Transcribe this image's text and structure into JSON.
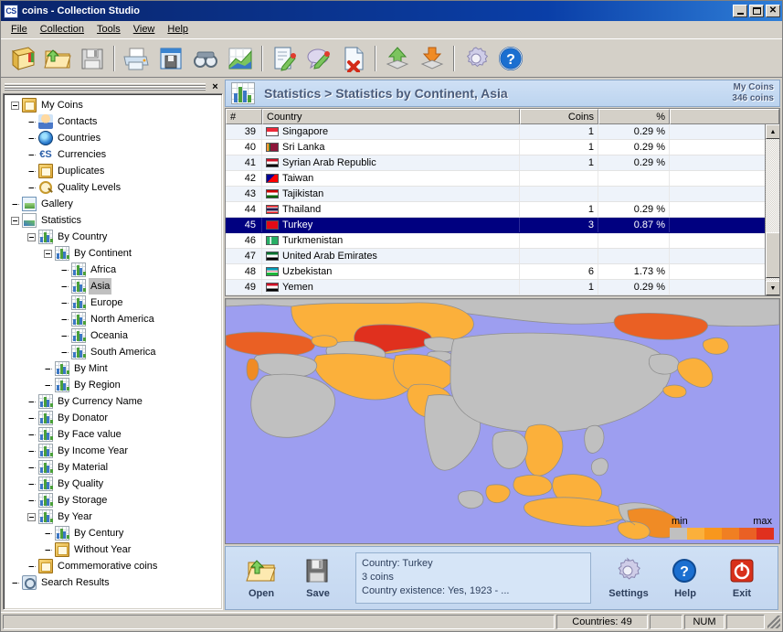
{
  "window": {
    "title": "coins - Collection Studio",
    "icon": "CS",
    "buttons": {
      "minimize": "minimize-button",
      "maximize": "maximize-button",
      "close": "close-button"
    }
  },
  "menu": [
    {
      "label": "File",
      "accel": "F"
    },
    {
      "label": "Collection",
      "accel": "C"
    },
    {
      "label": "Tools",
      "accel": "T"
    },
    {
      "label": "View",
      "accel": "V"
    },
    {
      "label": "Help",
      "accel": "H"
    }
  ],
  "toolbar": {
    "groups": [
      [
        {
          "name": "new-collection-icon"
        },
        {
          "name": "open-collection-icon"
        },
        {
          "name": "save-collection-icon"
        }
      ],
      [
        {
          "name": "print-icon"
        },
        {
          "name": "export-window-icon"
        },
        {
          "name": "find-icon"
        },
        {
          "name": "statistics-icon"
        }
      ],
      [
        {
          "name": "edit-item-icon"
        },
        {
          "name": "edit-comment-icon"
        },
        {
          "name": "delete-item-icon"
        }
      ],
      [
        {
          "name": "import-icon"
        },
        {
          "name": "export-icon"
        }
      ],
      [
        {
          "name": "settings-icon"
        },
        {
          "name": "help-icon"
        }
      ]
    ]
  },
  "sidebar": {
    "close_label": "×",
    "tree": [
      {
        "label": "My Coins",
        "depth": 0,
        "icon": "ic-book",
        "expander": "minus"
      },
      {
        "label": "Contacts",
        "depth": 1,
        "icon": "ic-person",
        "expander": "none"
      },
      {
        "label": "Countries",
        "depth": 1,
        "icon": "ic-globe",
        "expander": "none"
      },
      {
        "label": "Currencies",
        "depth": 1,
        "icon": "ic-currency",
        "expander": "none",
        "glyph": "€S"
      },
      {
        "label": "Duplicates",
        "depth": 1,
        "icon": "ic-book",
        "expander": "none"
      },
      {
        "label": "Quality Levels",
        "depth": 1,
        "icon": "ic-magnify",
        "expander": "none"
      },
      {
        "label": "Gallery",
        "depth": 0,
        "icon": "ic-gallery",
        "expander": "none"
      },
      {
        "label": "Statistics",
        "depth": 0,
        "icon": "ic-trend",
        "expander": "minus"
      },
      {
        "label": "By Country",
        "depth": 1,
        "icon": "ic-chart",
        "expander": "minus"
      },
      {
        "label": "By Continent",
        "depth": 2,
        "icon": "ic-chart",
        "expander": "minus"
      },
      {
        "label": "Africa",
        "depth": 3,
        "icon": "ic-chart",
        "expander": "none"
      },
      {
        "label": "Asia",
        "depth": 3,
        "icon": "ic-chart",
        "expander": "none",
        "selected": true
      },
      {
        "label": "Europe",
        "depth": 3,
        "icon": "ic-chart",
        "expander": "none"
      },
      {
        "label": "North America",
        "depth": 3,
        "icon": "ic-chart",
        "expander": "none"
      },
      {
        "label": "Oceania",
        "depth": 3,
        "icon": "ic-chart",
        "expander": "none"
      },
      {
        "label": "South America",
        "depth": 3,
        "icon": "ic-chart",
        "expander": "none"
      },
      {
        "label": "By Mint",
        "depth": 2,
        "icon": "ic-chart",
        "expander": "none"
      },
      {
        "label": "By Region",
        "depth": 2,
        "icon": "ic-chart",
        "expander": "none"
      },
      {
        "label": "By Currency Name",
        "depth": 1,
        "icon": "ic-chart",
        "expander": "none"
      },
      {
        "label": "By Donator",
        "depth": 1,
        "icon": "ic-chart",
        "expander": "none"
      },
      {
        "label": "By Face value",
        "depth": 1,
        "icon": "ic-chart",
        "expander": "none"
      },
      {
        "label": "By Income Year",
        "depth": 1,
        "icon": "ic-chart",
        "expander": "none"
      },
      {
        "label": "By Material",
        "depth": 1,
        "icon": "ic-chart",
        "expander": "none"
      },
      {
        "label": "By Quality",
        "depth": 1,
        "icon": "ic-chart",
        "expander": "none"
      },
      {
        "label": "By Storage",
        "depth": 1,
        "icon": "ic-chart",
        "expander": "none"
      },
      {
        "label": "By Year",
        "depth": 1,
        "icon": "ic-chart",
        "expander": "minus"
      },
      {
        "label": "By Century",
        "depth": 2,
        "icon": "ic-chart",
        "expander": "none"
      },
      {
        "label": "Without Year",
        "depth": 2,
        "icon": "ic-book",
        "expander": "none"
      },
      {
        "label": "Commemorative coins",
        "depth": 1,
        "icon": "ic-book",
        "expander": "none"
      },
      {
        "label": "Search Results",
        "depth": 0,
        "icon": "ic-search",
        "expander": "none"
      }
    ]
  },
  "stat_header": {
    "title": "Statistics > Statistics by Continent, Asia",
    "collection_name": "My Coins",
    "collection_count": "346 coins"
  },
  "table": {
    "columns": [
      "#",
      "Country",
      "Coins",
      "%"
    ],
    "rows": [
      {
        "num": "39",
        "country": "Singapore",
        "coins": "1",
        "pct": "0.29 %",
        "flag": "linear-gradient(to bottom,#ed2939 0 50%,#ffffff 50% 100%)"
      },
      {
        "num": "40",
        "country": "Sri Lanka",
        "coins": "1",
        "pct": "0.29 %",
        "flag": "linear-gradient(to right,#ff9a2e 0 22%,#0b6634 22% 34%,#8d153a 34% 100%)"
      },
      {
        "num": "41",
        "country": "Syrian Arab Republic",
        "coins": "1",
        "pct": "0.29 %",
        "flag": "linear-gradient(to bottom,#ce1126 0 33%,#ffffff 33% 66%,#000000 66% 100%)"
      },
      {
        "num": "42",
        "country": "Taiwan",
        "coins": "",
        "pct": "",
        "flag": "linear-gradient(135deg,#000095 0 45%,#fe0000 45% 100%)"
      },
      {
        "num": "43",
        "country": "Tajikistan",
        "coins": "",
        "pct": "",
        "flag": "linear-gradient(to bottom,#cc0000 0 33%,#ffffff 33% 66%,#006600 66% 100%)"
      },
      {
        "num": "44",
        "country": "Thailand",
        "coins": "1",
        "pct": "0.29 %",
        "flag": "linear-gradient(to bottom,#ed1c24 0 18%,#ffffff 18% 33%,#241d4f 33% 66%,#ffffff 66% 82%,#ed1c24 82% 100%)"
      },
      {
        "num": "45",
        "country": "Turkey",
        "coins": "3",
        "pct": "0.87 %",
        "flag": "linear-gradient(to bottom,#e30a17,#e30a17)",
        "selected": true
      },
      {
        "num": "46",
        "country": "Turkmenistan",
        "coins": "",
        "pct": "",
        "flag": "linear-gradient(to right,#28ae66 0 28%,#ffffff 28% 40%,#28ae66 40% 100%)"
      },
      {
        "num": "47",
        "country": "United Arab Emirates",
        "coins": "",
        "pct": "",
        "flag": "linear-gradient(to bottom,#00732f 0 33%,#ffffff 33% 66%,#000000 66% 100%)"
      },
      {
        "num": "48",
        "country": "Uzbekistan",
        "coins": "6",
        "pct": "1.73 %",
        "flag": "linear-gradient(to bottom,#0099b5 0 30%,#ffffff 30% 37%,#ce1126 37% 43%,#ffffff 43% 63%,#1eb53a 63% 100%)"
      },
      {
        "num": "49",
        "country": "Yemen",
        "coins": "1",
        "pct": "0.29 %",
        "flag": "linear-gradient(to bottom,#ce1126 0 33%,#ffffff 33% 66%,#000000 66% 100%)"
      }
    ]
  },
  "map": {
    "legend_min": "min",
    "legend_max": "max",
    "ocean_color": "#9d9ef0",
    "nodata_color": "#c0c0c0",
    "border_color": "#8f8f8f",
    "scale_colors": [
      "#c0c0c0",
      "#fbb03b",
      "#f8971d",
      "#f07f22",
      "#ea6024",
      "#e0301e"
    ]
  },
  "actions": {
    "open_label": "Open",
    "save_label": "Save",
    "settings_label": "Settings",
    "help_label": "Help",
    "exit_label": "Exit",
    "info_line1": "Country: Turkey",
    "info_line2": "3 coins",
    "info_line3": "Country existence: Yes, 1923 - ..."
  },
  "statusbar": {
    "countries": "Countries: 49",
    "num_lock": "NUM"
  }
}
